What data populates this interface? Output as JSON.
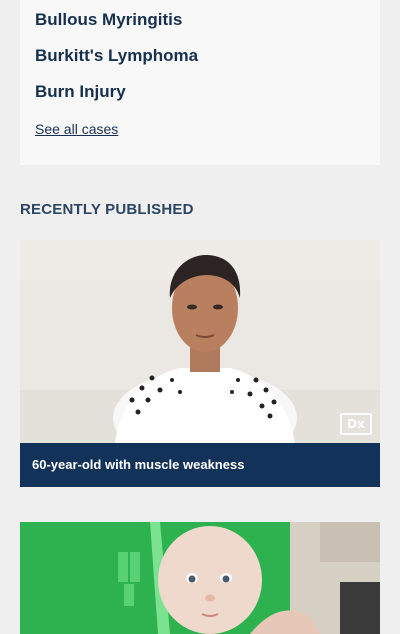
{
  "cases": {
    "items": [
      {
        "label": "Bullous Myringitis"
      },
      {
        "label": "Burkitt's Lymphoma"
      },
      {
        "label": "Burn Injury"
      }
    ],
    "see_all_label": "See all cases"
  },
  "recently_published": {
    "heading": "RECENTLY PUBLISHED",
    "articles": [
      {
        "caption": "60-year-old with muscle weakness",
        "badge": "Dx"
      },
      {
        "caption": ""
      }
    ]
  },
  "colors": {
    "page_bg": "#efefef",
    "card_bg": "#f8f8f8",
    "link": "#17304f",
    "caption_bar": "#13325a"
  }
}
